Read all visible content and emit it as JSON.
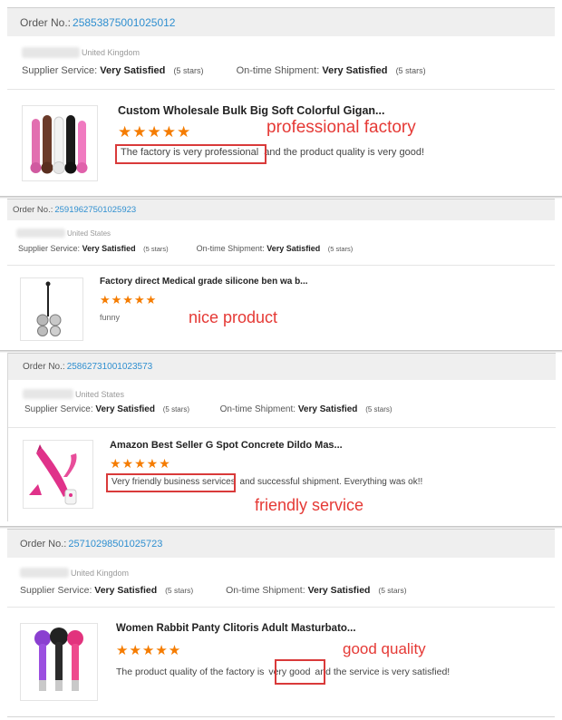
{
  "labels": {
    "order_prefix": "Order No.:",
    "supplier_label": "Supplier Service:",
    "shipment_label": "On-time Shipment:"
  },
  "orders": [
    {
      "order_no": "25853875001025012",
      "country": "United Kingdom",
      "supplier_rating": "Very Satisfied",
      "supplier_stars": "(5 stars)",
      "shipment_rating": "Very Satisfied",
      "shipment_stars": "(5 stars)",
      "product_title": "Custom Wholesale Bulk Big Soft Colorful Gigan...",
      "stars": "★★★★★",
      "review_highlight": "The factory is very professional",
      "review_rest": "and the product quality is very good!",
      "annotation": "professional factory"
    },
    {
      "order_no": "25919627501025923",
      "country": "United States",
      "supplier_rating": "Very Satisfied",
      "supplier_stars": "(5 stars)",
      "shipment_rating": "Very Satisfied",
      "shipment_stars": "(5 stars)",
      "product_title": "Factory direct Medical grade silicone ben wa b...",
      "stars": "★★★★★",
      "review": "funny",
      "annotation": "nice product"
    },
    {
      "order_no": "25862731001023573",
      "country": "United States",
      "supplier_rating": "Very Satisfied",
      "supplier_stars": "(5 stars)",
      "shipment_rating": "Very Satisfied",
      "shipment_stars": "(5 stars)",
      "product_title": "Amazon Best Seller G Spot Concrete Dildo Mas...",
      "stars": "★★★★★",
      "review_highlight": "Very friendly business services",
      "review_rest": "and successful shipment. Everything was ok!!",
      "annotation": "friendly service"
    },
    {
      "order_no": "25710298501025723",
      "country": "United Kingdom",
      "supplier_rating": "Very Satisfied",
      "supplier_stars": "(5 stars)",
      "shipment_rating": "Very Satisfied",
      "shipment_stars": "(5 stars)",
      "product_title": "Women Rabbit Panty Clitoris Adult Masturbato...",
      "stars": "★★★★★",
      "review_pre": "The product quality of the factory is",
      "review_highlight": "very good",
      "review_rest": "and the service is very satisfied!",
      "annotation": "good quality"
    }
  ],
  "colors": {
    "order_link": "#2f8fd0",
    "star": "#f57c00",
    "annotation": "#e53935",
    "highlight_box": "#d93a3a"
  }
}
